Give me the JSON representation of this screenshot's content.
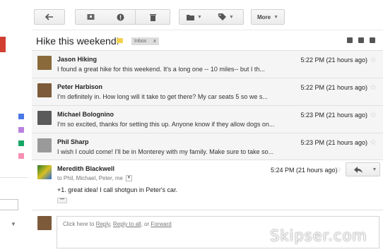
{
  "toolbar": {
    "back_icon": "arrow-left-icon",
    "archive_icon": "archive-icon",
    "spam_icon": "report-spam-icon",
    "delete_icon": "trash-icon",
    "folder_icon": "folder-icon",
    "label_icon": "label-tag-icon",
    "more_label": "More"
  },
  "subject": {
    "title": "Hike this weekend!",
    "label_chip": "Inbox",
    "label_chip_close": "x"
  },
  "messages": [
    {
      "sender": "Jason Hiking",
      "snippet": "I found a great hike for this weekend. It's a long one -- 10 miles-- but I th...",
      "time": "5:22 PM (21 hours ago)",
      "avatar_color": "#8a6a3a"
    },
    {
      "sender": "Peter Harbison",
      "snippet": "I'm definitely in. How long will it take to get there? My car seats 5 so we s...",
      "time": "5:22 PM (21 hours ago)",
      "avatar_color": "#7c5a3a"
    },
    {
      "sender": "Michael Bolognino",
      "snippet": "I'm so excited, thanks for setting this up. Anyone know if they allow dogs on...",
      "time": "5:23 PM (21 hours ago)",
      "avatar_color": "#5a5a5a"
    },
    {
      "sender": "Phil Sharp",
      "snippet": "I wish I could come! I'll be in Monterey with my family. Make sure to take so...",
      "time": "5:23 PM (21 hours ago)",
      "avatar_color": "#9a9a9a"
    }
  ],
  "expanded": {
    "sender": "Meredith Blackwell",
    "to": "to Phil, Michael, Peter, me",
    "body": "+1. great idea! I call shotgun in Peter's car.",
    "time": "5:24 PM (21 hours ago)",
    "dots": "•••"
  },
  "reply": {
    "prefix": "Click here to ",
    "reply": "Reply",
    "sep1": ", ",
    "reply_all": "Reply to all",
    "sep2": ", or ",
    "forward": "Forward"
  },
  "watermark": "Skipser.com"
}
